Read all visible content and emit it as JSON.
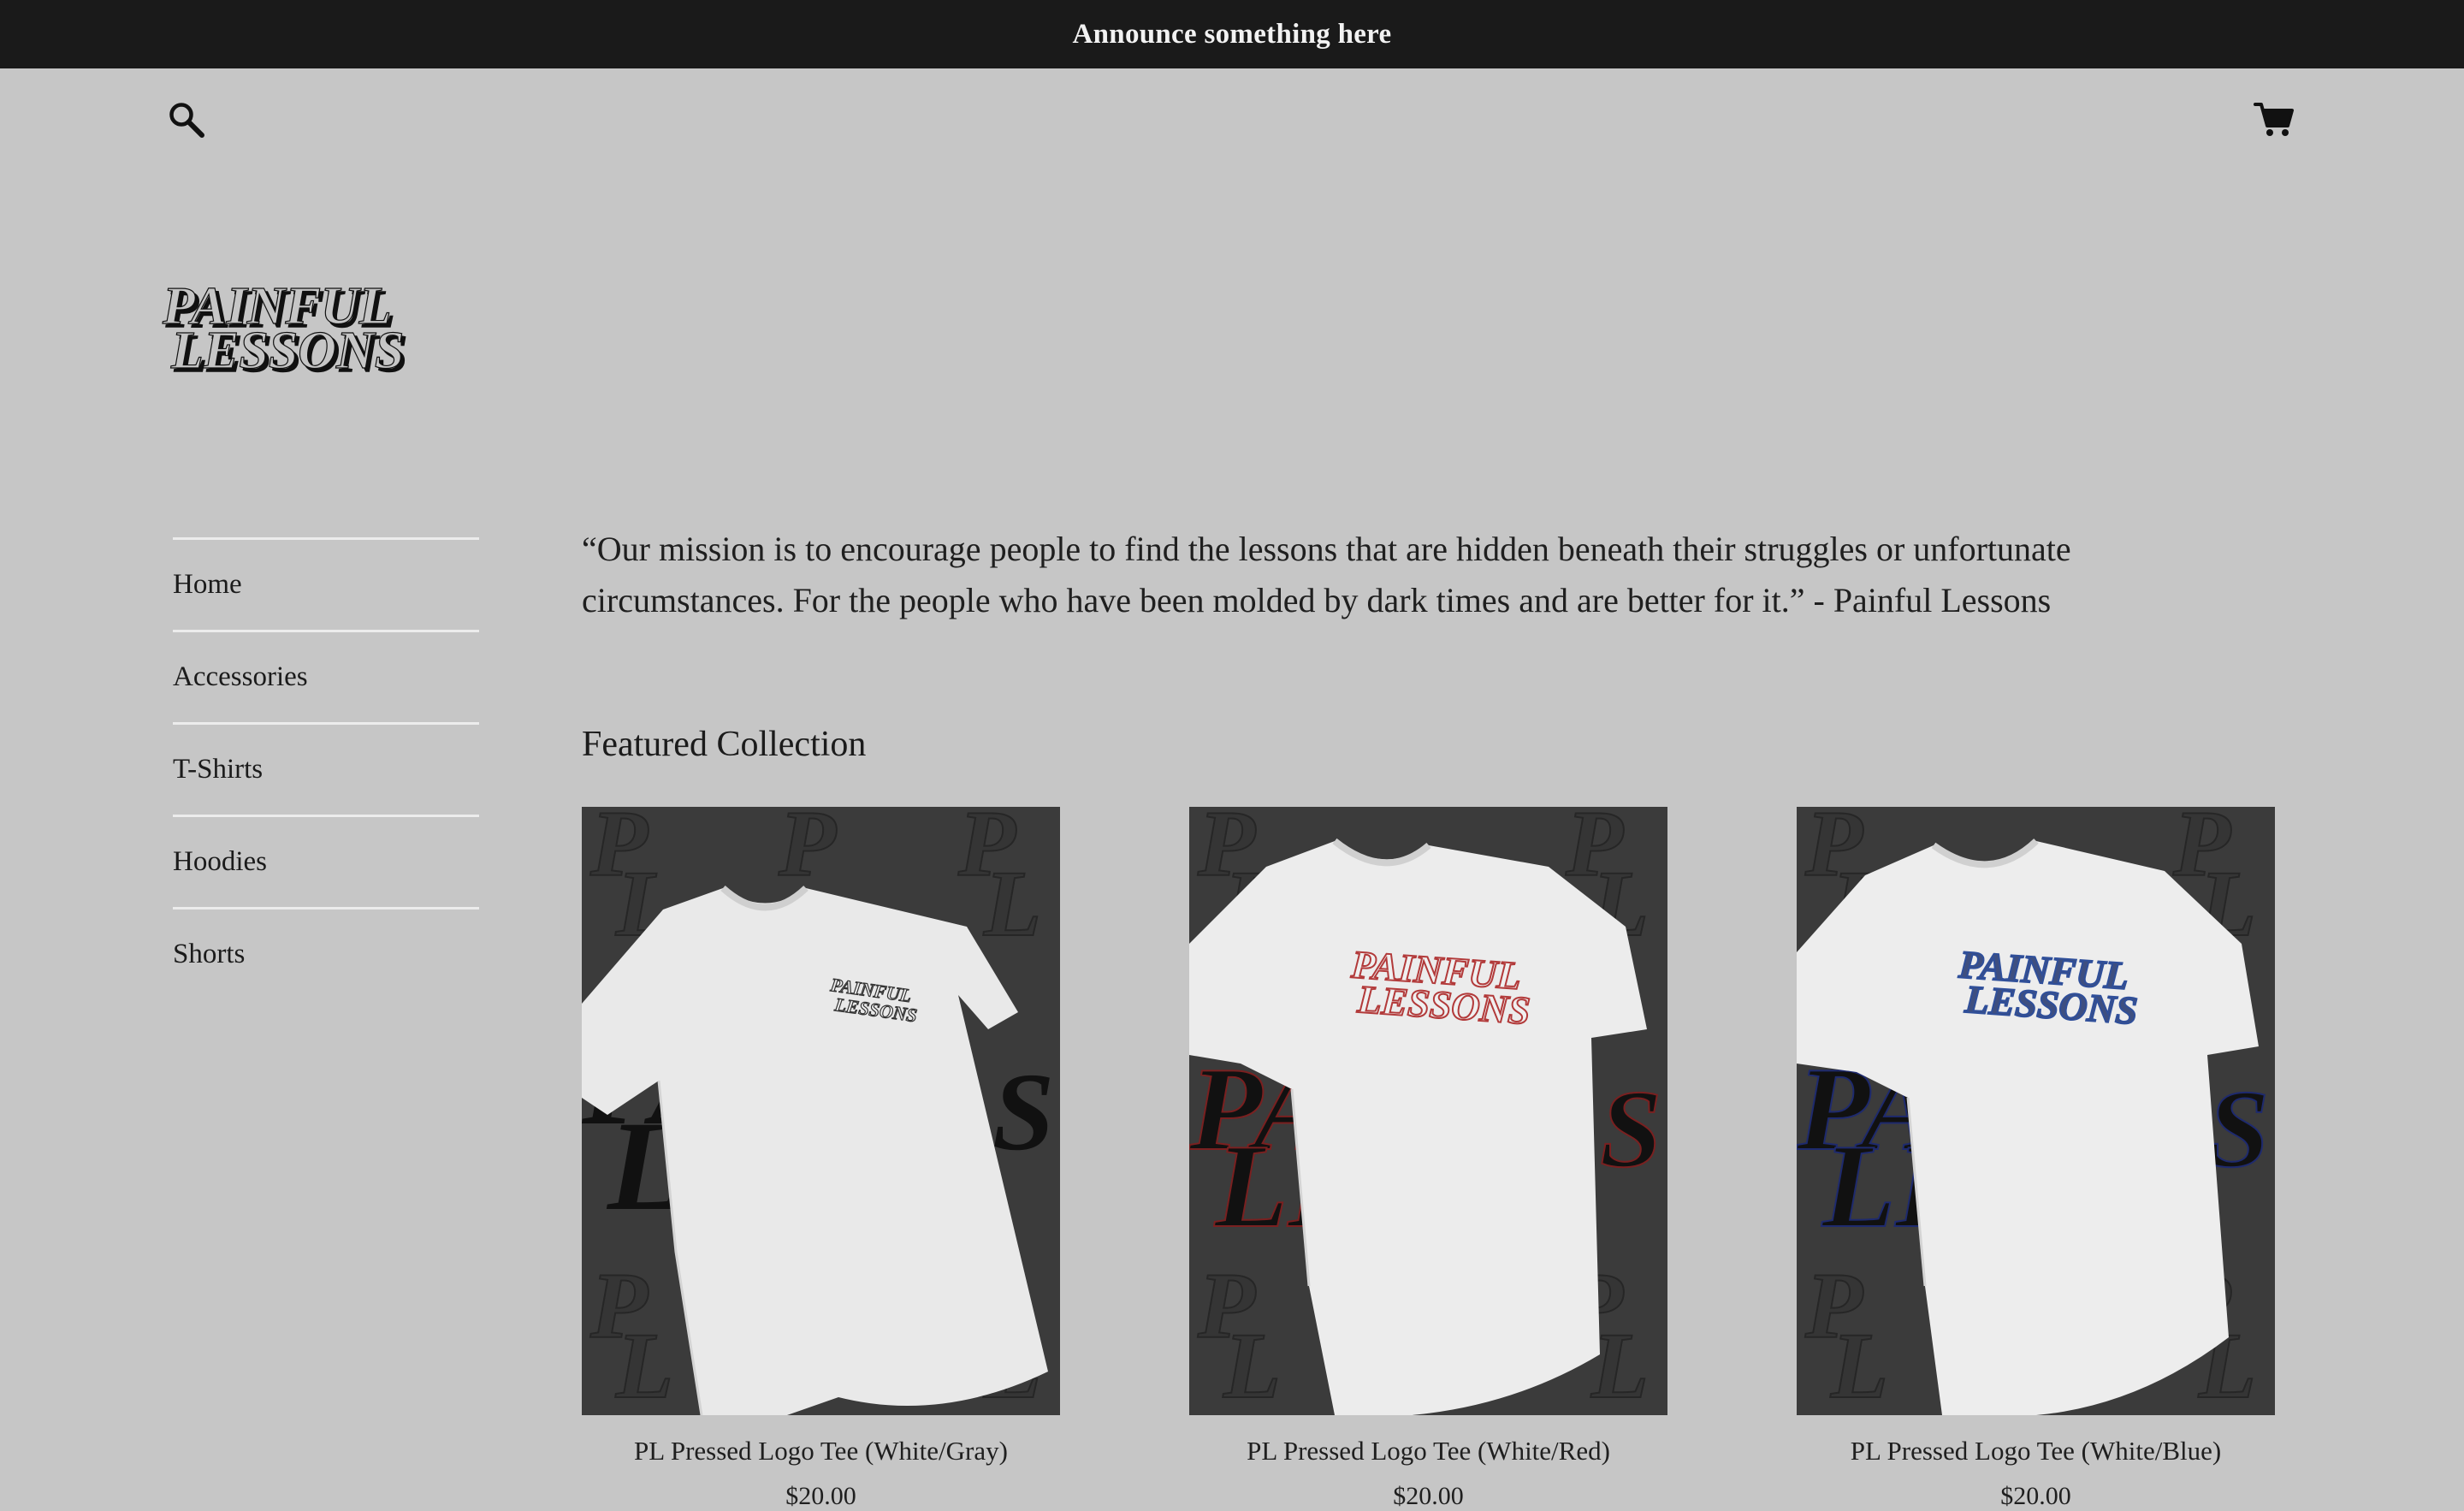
{
  "announcement": {
    "text": "Announce something here"
  },
  "header": {
    "search_icon": "search-icon",
    "cart_icon": "cart-icon"
  },
  "brand": {
    "logo_text": "PAINFUL LESSONS"
  },
  "nav": {
    "items": [
      {
        "label": "Home"
      },
      {
        "label": "Accessories"
      },
      {
        "label": "T-Shirts"
      },
      {
        "label": "Hoodies"
      },
      {
        "label": "Shorts"
      }
    ]
  },
  "mission": {
    "text": "“Our mission is to encourage people to find the lessons that are hidden beneath their struggles or unfortunate circumstances. For the people who have been molded by dark times and are better for it.” - Painful Lessons"
  },
  "featured": {
    "title": "Featured Collection",
    "products": [
      {
        "name": "PL Pressed Logo Tee (White/Gray)",
        "price": "$20.00",
        "accent": "#555555"
      },
      {
        "name": "PL Pressed Logo Tee (White/Red)",
        "price": "$20.00",
        "accent": "#b23a3a"
      },
      {
        "name": "PL Pressed Logo Tee (White/Blue)",
        "price": "$20.00",
        "accent": "#2f4f9a"
      }
    ]
  },
  "colors": {
    "background": "#c6c6c6",
    "announcement_bar": "#1a1a1a",
    "product_bg": "#3b3b3b"
  }
}
